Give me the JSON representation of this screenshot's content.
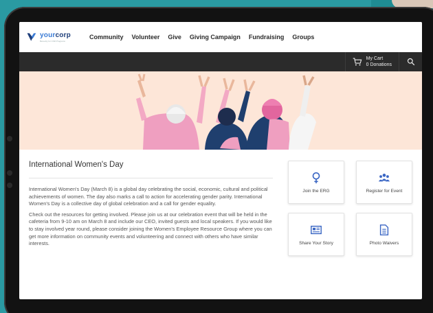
{
  "brand": {
    "name_a": "your",
    "name_b": "corp",
    "tagline": "Benevity for CSR Programs"
  },
  "nav": {
    "items": [
      "Community",
      "Volunteer",
      "Give",
      "Giving Campaign",
      "Fundraising",
      "Groups"
    ]
  },
  "cart": {
    "title": "My Cart",
    "count": "0 Donations"
  },
  "article": {
    "title": "International Women's Day",
    "paragraph1": "International Women's Day (March 8) is a global day celebrating the social, economic, cultural and political achievements of women. The day also marks a call to action for accelerating gender parity. International Women's Day is a collective day of global celebration and a call for gender equality.",
    "paragraph2": "Check out the resources for getting involved. Please join us at our celebration event that will be held in the cafeteria from 9-10 am on March 8 and include our CEO, invited guests and local speakers. If you would like to stay involved year round, please consider joining the Women's Employee Resource Group where you can get more information on community events and volunteering and connect with others who have similar interests."
  },
  "cards": [
    {
      "label": "Join the ERG",
      "icon": "female-symbol-icon"
    },
    {
      "label": "Register for Event",
      "icon": "group-icon"
    },
    {
      "label": "Share Your Story",
      "icon": "newspaper-icon"
    },
    {
      "label": "Photo Waivers",
      "icon": "document-icon"
    }
  ],
  "colors": {
    "accent": "#3a66c4",
    "hero_bg": "#fde6d8",
    "subbar": "#2b2b2b",
    "page_bg": "#2a9aa2"
  }
}
